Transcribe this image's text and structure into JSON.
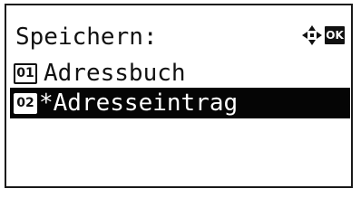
{
  "screen": {
    "title": "Speichern:",
    "ok_label": "OK"
  },
  "menu": {
    "items": [
      {
        "number": "01",
        "label": "Adressbuch",
        "selected": false
      },
      {
        "number": "02",
        "label": "*Adresseintrag",
        "selected": true
      }
    ]
  },
  "icons": {
    "nav": "four-way-arrows-icon",
    "ok": "ok-key-icon"
  },
  "colors": {
    "text": "#111111",
    "highlight_bg": "#050505",
    "highlight_text": "#ffffff",
    "screen_bg": "#ffffff"
  }
}
